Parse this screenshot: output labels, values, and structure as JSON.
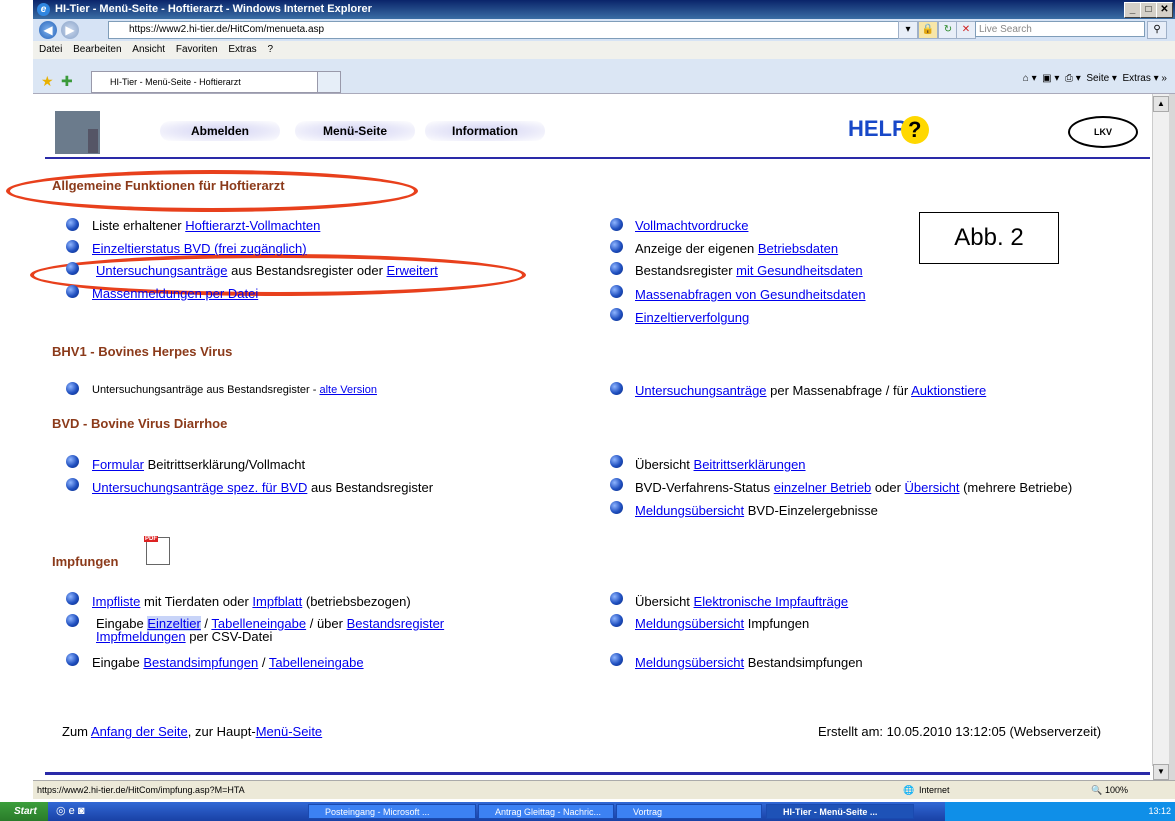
{
  "window": {
    "title": "HI-Tier - Menü-Seite - Hoftierarzt - Windows Internet Explorer"
  },
  "address": {
    "url": "https://www2.hi-tier.de/HitCom/menueta.asp",
    "search_placeholder": "Live Search"
  },
  "menubar": [
    "Datei",
    "Bearbeiten",
    "Ansicht",
    "Favoriten",
    "Extras",
    "?"
  ],
  "tab": {
    "label": "HI-Tier - Menü-Seite - Hoftierarzt"
  },
  "toolbar": {
    "seite": "Seite",
    "extras": "Extras"
  },
  "header": {
    "nav": [
      "Abmelden",
      "Menü-Seite",
      "Information"
    ],
    "help": "HELP",
    "lkv": "LKV"
  },
  "annotation": {
    "label": "Abb. 2"
  },
  "sections": {
    "allgemein": {
      "title": "Allgemeine Funktionen für Hoftierarzt",
      "l1_pre": "Liste erhaltener ",
      "l1_link": "Hoftierarzt-Vollmachten",
      "l2_link": "Einzeltierstatus BVD (frei zugänglich)",
      "l3_link1": "Untersuchungsanträge",
      "l3_mid": " aus Bestandsregister oder ",
      "l3_link2": "Erweitert",
      "l4_link": "Massenmeldungen per Datei",
      "r1_link": "Vollmachtvordrucke",
      "r2_pre": "Anzeige der eigenen ",
      "r2_link": "Betriebsdaten",
      "r3_pre": "Bestandsregister ",
      "r3_link": "mit Gesundheitsdaten",
      "r4_link": "Massenabfragen von Gesundheitsdaten",
      "r5_link": "Einzeltierverfolgung"
    },
    "bhv1": {
      "title": "BHV1 - Bovines Herpes Virus",
      "l1_pre": "Untersuchungsanträge aus Bestandsregister - ",
      "l1_link": "alte Version",
      "r1_link": "Untersuchungsanträge",
      "r1_mid": " per Massenabfrage / für ",
      "r1_link2": "Auktionstiere"
    },
    "bvd": {
      "title": "BVD - Bovine Virus  Diarrhoe",
      "l1_link": "Formular",
      "l1_post": " Beitrittserklärung/Vollmacht",
      "l2_link": "Untersuchungsanträge spez. für BVD",
      "l2_post": " aus Bestandsregister",
      "r1_pre": "Übersicht ",
      "r1_link": "Beitrittserklärungen",
      "r2_pre": "BVD-Verfahrens-Status ",
      "r2_link": "einzelner Betrieb",
      "r2_mid": " oder ",
      "r2_link2": "Übersicht",
      "r2_post": " (mehrere Betriebe)",
      "r3_link": "Meldungsübersicht",
      "r3_post": " BVD-Einzelergebnisse"
    },
    "impf": {
      "title": "Impfungen",
      "pdf_label": "PDF",
      "l1_link": "Impfliste",
      "l1_mid": " mit Tierdaten oder ",
      "l1_link2": "Impfblatt",
      "l1_post": " (betriebsbezogen)",
      "l2_pre": "Eingabe ",
      "l2_link": "Einzeltier",
      "l2_mid": " / ",
      "l2_link2": "Tabelleneingabe",
      "l2_mid2": " / über ",
      "l2_link3": "Bestandsregister",
      "l2b_link": "Impfmeldungen",
      "l2b_post": " per CSV-Datei",
      "l3_pre": "Eingabe ",
      "l3_link": "Bestandsimpfungen",
      "l3_mid": " / ",
      "l3_link2": "Tabelleneingabe",
      "r1_pre": "Übersicht ",
      "r1_link": "Elektronische Impfaufträge",
      "r2_link": "Meldungsübersicht",
      "r2_post": " Impfungen",
      "r3_link": "Meldungsübersicht",
      "r3_post": " Bestandsimpfungen"
    }
  },
  "footer": {
    "pre": "Zum ",
    "link1": "Anfang der Seite",
    "mid": ",   zur Haupt-",
    "link2": "Menü-Seite",
    "created": "Erstellt am: 10.05.2010 13:12:05 (Webserverzeit)"
  },
  "statusbar": {
    "url": "https://www2.hi-tier.de/HitCom/impfung.asp?M=HTA",
    "zone": "Internet",
    "zoom": "100%"
  },
  "taskbar": {
    "start": "Start",
    "tasks": [
      "Posteingang - Microsoft ...",
      "Antrag Gleittag - Nachric...",
      "Vortrag",
      "HI-Tier - Menü-Seite ..."
    ],
    "clock": "13:12"
  },
  "colors": {
    "section_heading": "#8b3a1a",
    "link": "#0000ee",
    "annotation_oval": "#e8401c",
    "divider": "#2a2aa8"
  }
}
